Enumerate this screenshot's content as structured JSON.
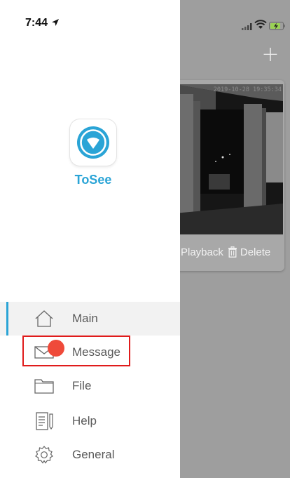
{
  "status_bar": {
    "time": "7:44"
  },
  "app": {
    "name": "ToSee"
  },
  "menu": {
    "items": [
      {
        "label": "Main",
        "icon": "home-icon"
      },
      {
        "label": "Message",
        "icon": "envelope-icon"
      },
      {
        "label": "File",
        "icon": "folder-icon"
      },
      {
        "label": "Help",
        "icon": "document-icon"
      },
      {
        "label": "General",
        "icon": "gear-icon"
      }
    ],
    "selected": "Main"
  },
  "background": {
    "camera_card": {
      "timestamp": "2019-10-28 19:35:34",
      "playback_label": "Playback",
      "delete_label": "Delete"
    }
  },
  "colors": {
    "accent": "#2aa4d6",
    "badge": "#ef4a3a",
    "highlight_box": "#e01b1b",
    "overlay": "#9e9e9e"
  }
}
